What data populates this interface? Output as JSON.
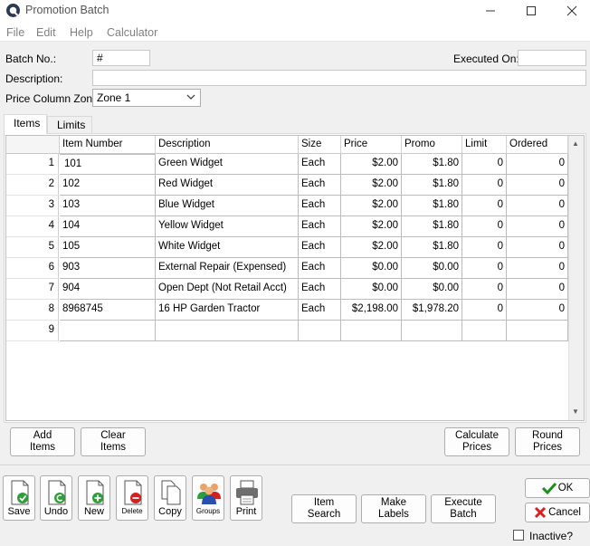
{
  "window": {
    "title": "Promotion Batch"
  },
  "menu": [
    "File",
    "Edit",
    "Help",
    "Calculator"
  ],
  "form": {
    "batch_no_label": "Batch No.:",
    "batch_no_value": "#",
    "executed_on_label": "Executed On:",
    "executed_on_value": "",
    "description_label": "Description:",
    "description_value": "",
    "zone_label": "Price Column Zone:",
    "zone_value": "Zone 1"
  },
  "tabs": [
    "Items",
    "Limits"
  ],
  "grid": {
    "columns": [
      "Item Number",
      "Description",
      "Size",
      "Price",
      "Promo",
      "Limit",
      "Ordered"
    ],
    "rows": [
      {
        "n": "1",
        "item": "101",
        "desc": "Green Widget",
        "size": "Each",
        "price": "$2.00",
        "promo": "$1.80",
        "limit": "0",
        "ordered": "0"
      },
      {
        "n": "2",
        "item": "102",
        "desc": "Red Widget",
        "size": "Each",
        "price": "$2.00",
        "promo": "$1.80",
        "limit": "0",
        "ordered": "0"
      },
      {
        "n": "3",
        "item": "103",
        "desc": "Blue Widget",
        "size": "Each",
        "price": "$2.00",
        "promo": "$1.80",
        "limit": "0",
        "ordered": "0"
      },
      {
        "n": "4",
        "item": "104",
        "desc": "Yellow Widget",
        "size": "Each",
        "price": "$2.00",
        "promo": "$1.80",
        "limit": "0",
        "ordered": "0"
      },
      {
        "n": "5",
        "item": "105",
        "desc": "White Widget",
        "size": "Each",
        "price": "$2.00",
        "promo": "$1.80",
        "limit": "0",
        "ordered": "0"
      },
      {
        "n": "6",
        "item": "903",
        "desc": "External Repair (Expensed)",
        "size": "Each",
        "price": "$0.00",
        "promo": "$0.00",
        "limit": "0",
        "ordered": "0"
      },
      {
        "n": "7",
        "item": "904",
        "desc": "Open Dept (Not Retail Acct)",
        "size": "Each",
        "price": "$0.00",
        "promo": "$0.00",
        "limit": "0",
        "ordered": "0"
      },
      {
        "n": "8",
        "item": "8968745",
        "desc": "16 HP Garden Tractor",
        "size": "Each",
        "price": "$2,198.00",
        "promo": "$1,978.20",
        "limit": "0",
        "ordered": "0"
      },
      {
        "n": "9",
        "item": "",
        "desc": "",
        "size": "",
        "price": "",
        "promo": "",
        "limit": "",
        "ordered": ""
      }
    ]
  },
  "buttons": {
    "add_items": [
      "Add",
      "Items"
    ],
    "clear_items": [
      "Clear",
      "Items"
    ],
    "calculate_prices": [
      "Calculate",
      "Prices"
    ],
    "round_prices": [
      "Round",
      "Prices"
    ],
    "item_search": [
      "Item",
      "Search"
    ],
    "make_labels": [
      "Make",
      "Labels"
    ],
    "execute_batch": [
      "Execute",
      "Batch"
    ],
    "ok": "OK",
    "cancel": "Cancel"
  },
  "toolbar": [
    "Save",
    "Undo",
    "New",
    "Delete",
    "Copy",
    "Groups",
    "Print"
  ],
  "inactive_label": "Inactive?",
  "colors": {
    "ok_check": "#1a8f1a",
    "cancel_x": "#d42020",
    "add_green": "#2e9d3a",
    "delete_red": "#d42020"
  }
}
